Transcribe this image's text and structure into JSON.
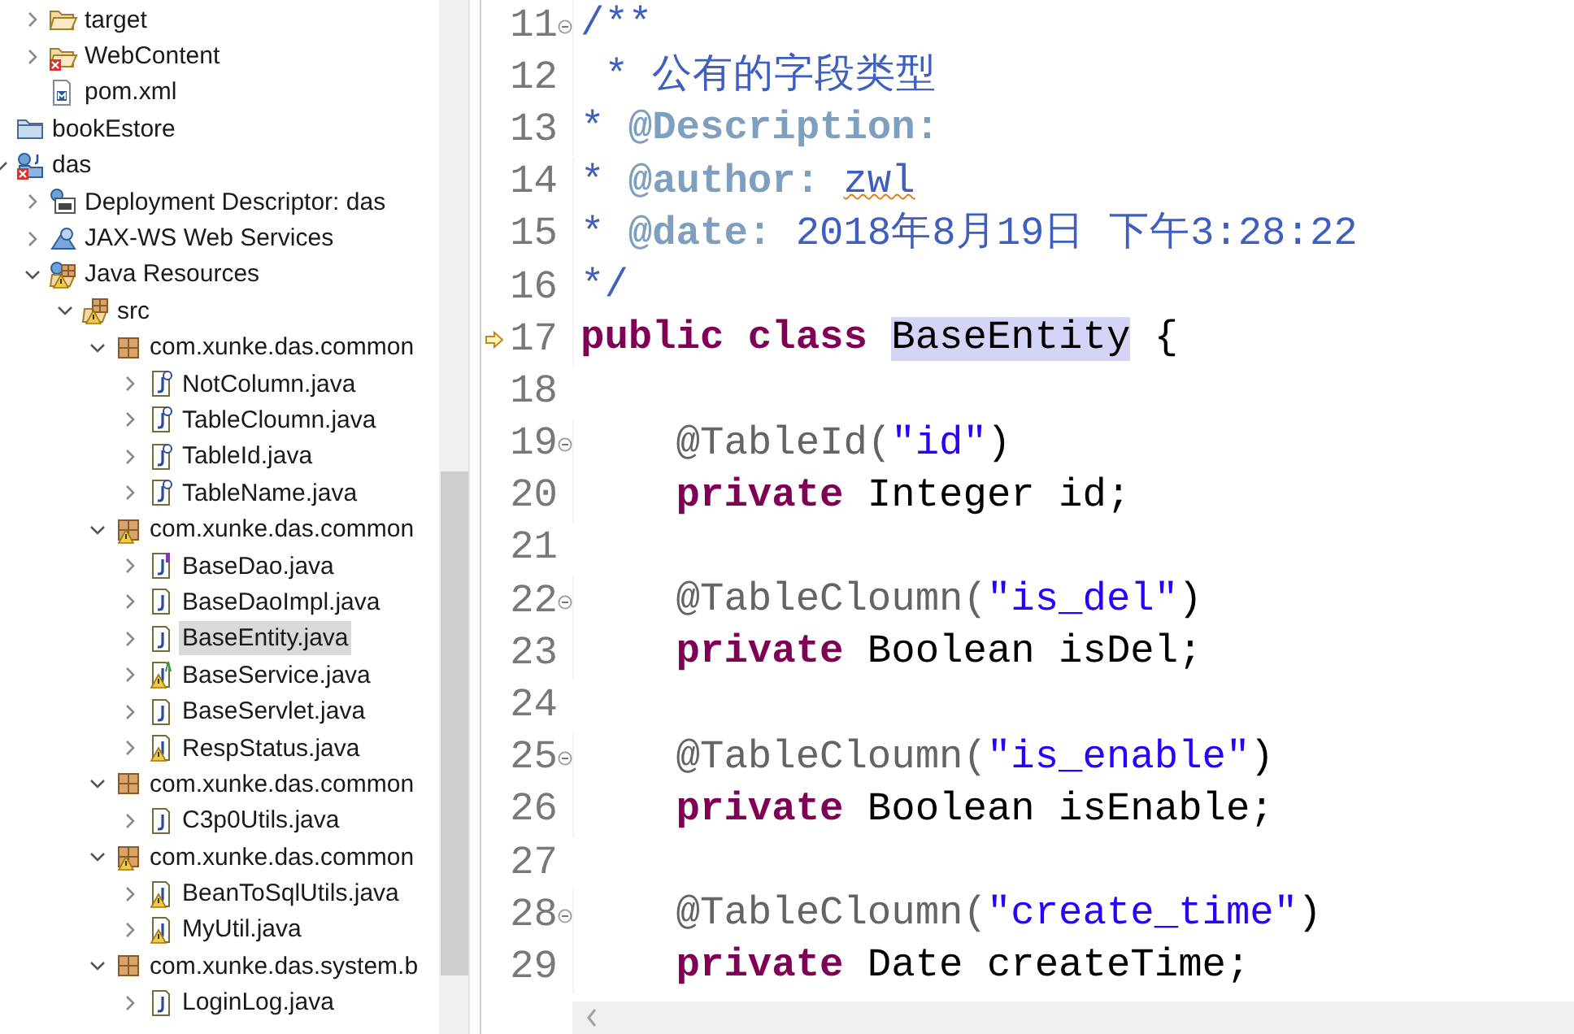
{
  "project_explorer": {
    "orphan_items": [
      {
        "label": "target",
        "kind": "folder",
        "expanded": false,
        "error": false
      },
      {
        "label": "WebContent",
        "kind": "folder",
        "expanded": false,
        "error": true
      },
      {
        "label": "pom.xml",
        "kind": "xml-file"
      }
    ],
    "items": [
      {
        "label": "bookEstore",
        "kind": "project"
      },
      {
        "label": "das",
        "kind": "web-project",
        "expanded": true,
        "error": true,
        "children": [
          {
            "label": "Deployment Descriptor: das",
            "kind": "descriptor",
            "expanded": false
          },
          {
            "label": "JAX-WS Web Services",
            "kind": "web-services",
            "expanded": false
          },
          {
            "label": "Java Resources",
            "kind": "java-resources",
            "expanded": true,
            "warning": true,
            "children": [
              {
                "label": "src",
                "kind": "source-folder",
                "expanded": true,
                "warning": true,
                "children": [
                  {
                    "label": "com.xunke.das.common",
                    "kind": "package",
                    "expanded": true,
                    "warning": false,
                    "children": [
                      {
                        "label": "NotColumn.java",
                        "kind": "annotation-file",
                        "expanded": false,
                        "selected": false
                      },
                      {
                        "label": "TableCloumn.java",
                        "kind": "annotation-file",
                        "expanded": false,
                        "selected": false
                      },
                      {
                        "label": "TableId.java",
                        "kind": "annotation-file",
                        "expanded": false,
                        "selected": false
                      },
                      {
                        "label": "TableName.java",
                        "kind": "annotation-file",
                        "expanded": false,
                        "selected": false
                      }
                    ]
                  },
                  {
                    "label": "com.xunke.das.common",
                    "kind": "package",
                    "expanded": true,
                    "warning": true,
                    "children": [
                      {
                        "label": "BaseDao.java",
                        "kind": "interface-file",
                        "expanded": false,
                        "selected": false,
                        "warning": false
                      },
                      {
                        "label": "BaseDaoImpl.java",
                        "kind": "class-file",
                        "expanded": false,
                        "selected": false,
                        "warning": false
                      },
                      {
                        "label": "BaseEntity.java",
                        "kind": "class-file",
                        "expanded": false,
                        "selected": true,
                        "warning": false
                      },
                      {
                        "label": "BaseService.java",
                        "kind": "abstract-file",
                        "expanded": false,
                        "selected": false,
                        "warning": true
                      },
                      {
                        "label": "BaseServlet.java",
                        "kind": "class-file",
                        "expanded": false,
                        "selected": false,
                        "warning": false
                      },
                      {
                        "label": "RespStatus.java",
                        "kind": "class-file",
                        "expanded": false,
                        "selected": false,
                        "warning": true
                      }
                    ]
                  },
                  {
                    "label": "com.xunke.das.common",
                    "kind": "package",
                    "expanded": true,
                    "warning": false,
                    "children": [
                      {
                        "label": "C3p0Utils.java",
                        "kind": "class-file",
                        "expanded": false,
                        "selected": false,
                        "warning": false
                      }
                    ]
                  },
                  {
                    "label": "com.xunke.das.common",
                    "kind": "package",
                    "expanded": true,
                    "warning": true,
                    "children": [
                      {
                        "label": "BeanToSqlUtils.java",
                        "kind": "class-file",
                        "expanded": false,
                        "selected": false,
                        "warning": true
                      },
                      {
                        "label": "MyUtil.java",
                        "kind": "class-file",
                        "expanded": false,
                        "selected": false,
                        "warning": true
                      }
                    ]
                  },
                  {
                    "label": "com.xunke.das.system.b",
                    "kind": "package",
                    "expanded": true,
                    "warning": false,
                    "children": [
                      {
                        "label": "LoginLog.java",
                        "kind": "class-file",
                        "expanded": false,
                        "selected": false,
                        "warning": false
                      }
                    ]
                  }
                ]
              }
            ]
          }
        ]
      }
    ]
  },
  "editor": {
    "lines": [
      {
        "number": "11",
        "fold": true,
        "marker": false,
        "tokens": [
          {
            "text": "/**",
            "kind": "comment"
          }
        ]
      },
      {
        "number": "12",
        "fold": false,
        "marker": false,
        "tokens": [
          {
            "text": " * 公有的字段类型",
            "kind": "comment"
          }
        ]
      },
      {
        "number": "13",
        "fold": false,
        "marker": false,
        "tokens": [
          {
            "text": "* ",
            "kind": "comment"
          },
          {
            "text": "@Description:",
            "kind": "doc-tag"
          }
        ]
      },
      {
        "number": "14",
        "fold": false,
        "marker": false,
        "tokens": [
          {
            "text": "* ",
            "kind": "comment"
          },
          {
            "text": "@author: ",
            "kind": "doc-tag"
          },
          {
            "text": "zwl",
            "kind": "misspelled"
          }
        ]
      },
      {
        "number": "15",
        "fold": false,
        "marker": false,
        "tokens": [
          {
            "text": "* ",
            "kind": "comment"
          },
          {
            "text": "@date:",
            "kind": "doc-tag"
          },
          {
            "text": " 2018年8月19日 下午3:28:22",
            "kind": "comment"
          }
        ]
      },
      {
        "number": "16",
        "fold": false,
        "marker": false,
        "tokens": [
          {
            "text": "*/",
            "kind": "comment"
          }
        ]
      },
      {
        "number": "17",
        "fold": false,
        "marker": true,
        "tokens": [
          {
            "text": "public class ",
            "kind": "keyword"
          },
          {
            "text": "BaseEntity",
            "kind": "occurrence"
          },
          {
            "text": " {",
            "kind": "plain"
          }
        ]
      },
      {
        "number": "18",
        "fold": false,
        "marker": false
      },
      {
        "number": "19",
        "fold": true,
        "marker": false,
        "tokens": [
          {
            "text": "    @TableId(",
            "kind": "annotation"
          },
          {
            "text": "\"id\"",
            "kind": "string"
          },
          {
            "text": ")",
            "kind": "plain"
          }
        ]
      },
      {
        "number": "20",
        "fold": false,
        "marker": false,
        "tokens": [
          {
            "text": "    private",
            "kind": "keyword"
          },
          {
            "text": " Integer id;",
            "kind": "plain"
          }
        ]
      },
      {
        "number": "21",
        "fold": false,
        "marker": false
      },
      {
        "number": "22",
        "fold": true,
        "marker": false,
        "tokens": [
          {
            "text": "    @TableCloumn(",
            "kind": "annotation"
          },
          {
            "text": "\"is_del\"",
            "kind": "string"
          },
          {
            "text": ")",
            "kind": "plain"
          }
        ]
      },
      {
        "number": "23",
        "fold": false,
        "marker": false,
        "tokens": [
          {
            "text": "    private",
            "kind": "keyword"
          },
          {
            "text": " Boolean isDel;",
            "kind": "plain"
          }
        ]
      },
      {
        "number": "24",
        "fold": false,
        "marker": false
      },
      {
        "number": "25",
        "fold": true,
        "marker": false,
        "tokens": [
          {
            "text": "    @TableCloumn(",
            "kind": "annotation"
          },
          {
            "text": "\"is_enable\"",
            "kind": "string"
          },
          {
            "text": ")",
            "kind": "plain"
          }
        ]
      },
      {
        "number": "26",
        "fold": false,
        "marker": false,
        "tokens": [
          {
            "text": "    private",
            "kind": "keyword"
          },
          {
            "text": " Boolean isEnable;",
            "kind": "plain"
          }
        ]
      },
      {
        "number": "27",
        "fold": false,
        "marker": false
      },
      {
        "number": "28",
        "fold": true,
        "marker": false,
        "tokens": [
          {
            "text": "    @TableCloumn(",
            "kind": "annotation"
          },
          {
            "text": "\"create_time\"",
            "kind": "string"
          },
          {
            "text": ")",
            "kind": "plain"
          }
        ]
      },
      {
        "number": "29",
        "fold": false,
        "marker": false,
        "tokens": [
          {
            "text": "    private",
            "kind": "keyword"
          },
          {
            "text": " Date createTime;",
            "kind": "plain"
          }
        ]
      }
    ]
  }
}
